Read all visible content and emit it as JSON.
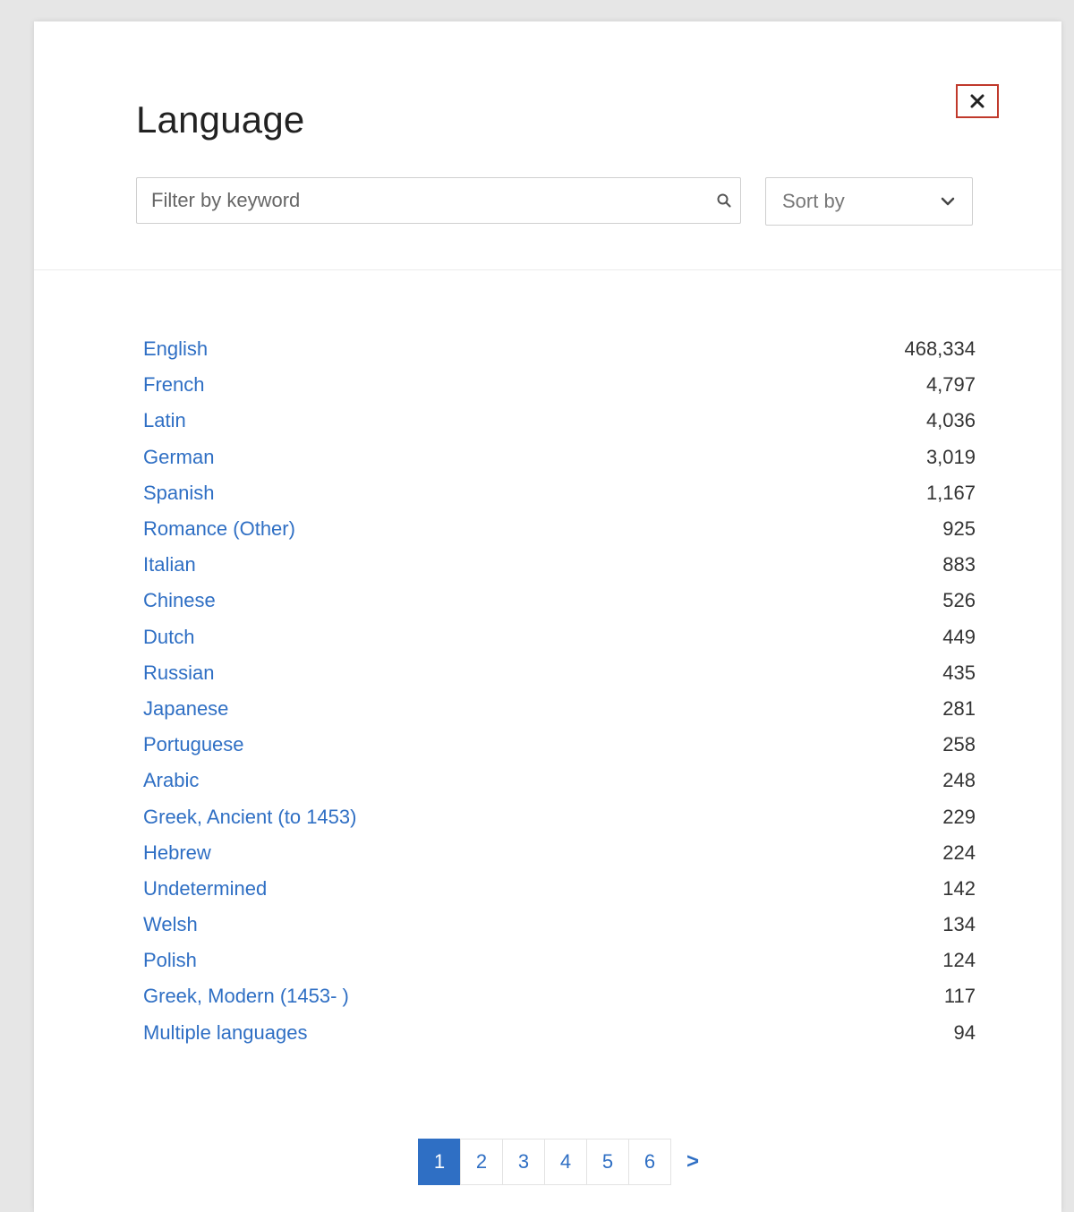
{
  "dialog": {
    "title": "Language",
    "close_icon": "close-icon"
  },
  "filter": {
    "placeholder": "Filter by keyword",
    "value": "",
    "icon": "search-icon"
  },
  "sort": {
    "label": "Sort by",
    "icon": "chevron-down-icon"
  },
  "languages": [
    {
      "name": "English",
      "count": "468,334"
    },
    {
      "name": "French",
      "count": "4,797"
    },
    {
      "name": "Latin",
      "count": "4,036"
    },
    {
      "name": "German",
      "count": "3,019"
    },
    {
      "name": "Spanish",
      "count": "1,167"
    },
    {
      "name": "Romance (Other)",
      "count": "925"
    },
    {
      "name": "Italian",
      "count": "883"
    },
    {
      "name": "Chinese",
      "count": "526"
    },
    {
      "name": "Dutch",
      "count": "449"
    },
    {
      "name": "Russian",
      "count": "435"
    },
    {
      "name": "Japanese",
      "count": "281"
    },
    {
      "name": "Portuguese",
      "count": "258"
    },
    {
      "name": "Arabic",
      "count": "248"
    },
    {
      "name": "Greek, Ancient (to 1453)",
      "count": "229"
    },
    {
      "name": "Hebrew",
      "count": "224"
    },
    {
      "name": "Undetermined",
      "count": "142"
    },
    {
      "name": "Welsh",
      "count": "134"
    },
    {
      "name": "Polish",
      "count": "124"
    },
    {
      "name": "Greek, Modern (1453- )",
      "count": "117"
    },
    {
      "name": "Multiple languages",
      "count": "94"
    }
  ],
  "pagination": {
    "pages": [
      "1",
      "2",
      "3",
      "4",
      "5",
      "6"
    ],
    "current": "1",
    "next_label": ">"
  },
  "colors": {
    "link": "#2f6fc4",
    "close_border": "#c0392b",
    "active_page_bg": "#2f6fc4"
  }
}
